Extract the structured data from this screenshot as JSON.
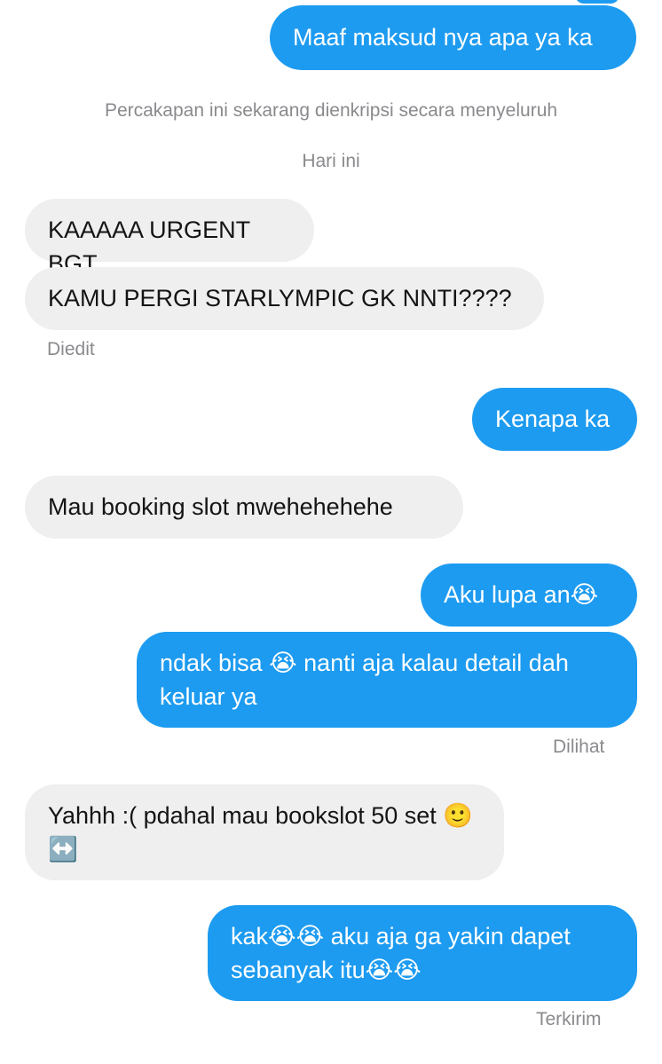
{
  "messages": [
    {
      "id": "m1",
      "text": "Maaf maksud nya apa ya ka"
    },
    {
      "id": "m2",
      "text": "KAAAAA URGENT BGT"
    },
    {
      "id": "m3",
      "text": "KAMU PERGI STARLYMPIC GK NNTI????"
    },
    {
      "id": "m4",
      "text": "Kenapa ka"
    },
    {
      "id": "m5",
      "text": "Mau booking slot mwehehehehe"
    },
    {
      "id": "m6",
      "text": "Aku lupa an😭"
    },
    {
      "id": "m7",
      "text": "ndak bisa 😭 nanti aja kalau detail dah keluar ya"
    },
    {
      "id": "m8",
      "text": "Yahhh :( pdahal mau bookslot 50 set 🙂↔️"
    },
    {
      "id": "m9",
      "text": "kak😭😭 aku aja ga yakin dapet sebanyak itu😭😭"
    }
  ],
  "system": {
    "encryption_notice": "Percakapan ini sekarang dienkripsi secara menyeluruh",
    "date_divider": "Hari ini"
  },
  "status": {
    "edited": "Diedit",
    "seen": "Dilihat",
    "sent": "Terkirim"
  },
  "colors": {
    "outgoing_bubble": "#1d9bf0",
    "incoming_bubble": "#efefef",
    "meta_text": "#8a8a8e"
  }
}
